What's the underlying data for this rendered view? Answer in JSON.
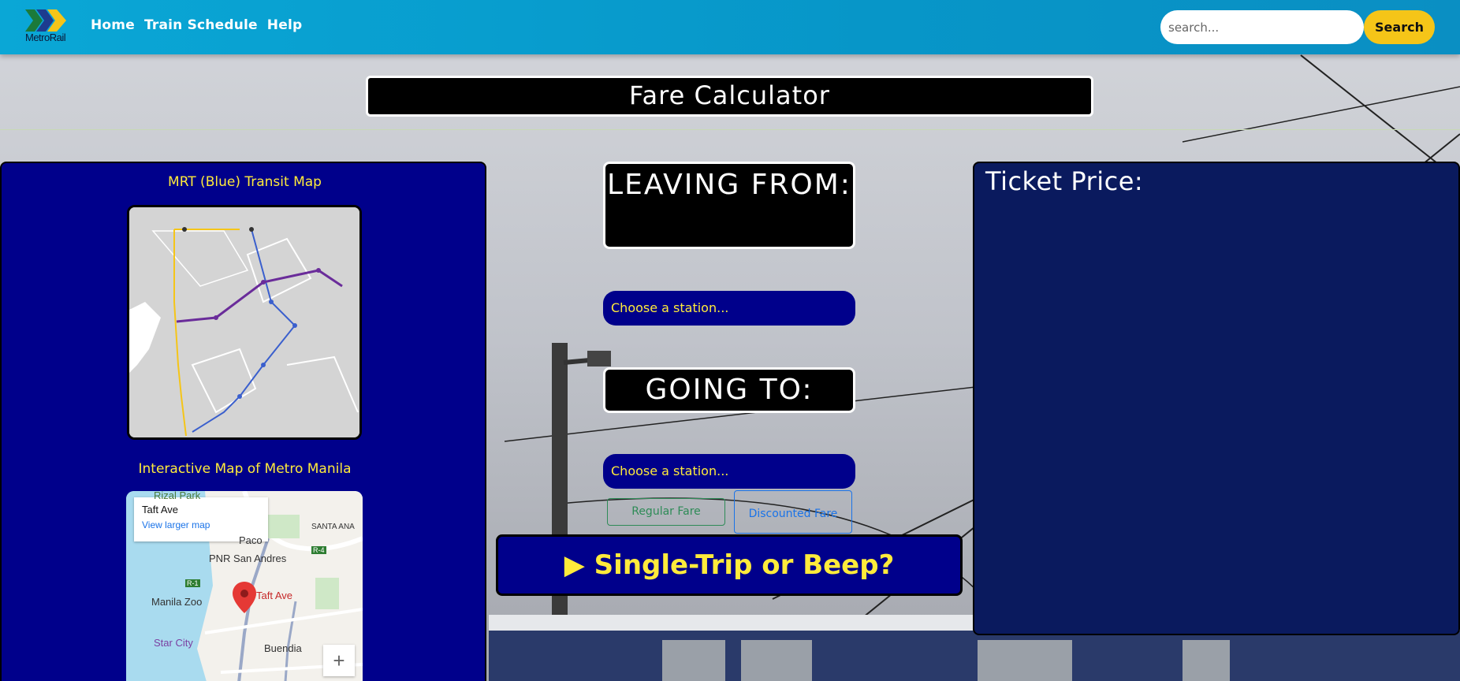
{
  "nav": {
    "logo_text": "MetroRail",
    "links": [
      "Home",
      "Train Schedule",
      "Help"
    ],
    "search_placeholder": "search...",
    "search_button": "Search"
  },
  "title": "Fare Calculator",
  "left_panel": {
    "transit_map_heading": "MRT (Blue) Transit Map",
    "interactive_map_heading": "Interactive Map of Metro Manila",
    "gmap": {
      "place_title": "Taft Ave",
      "view_larger": "View larger map",
      "labels": [
        "Rizal Park",
        "Paco",
        "PNR San Andres",
        "Manila Zoo",
        "Taft Ave",
        "Star City",
        "Buendia",
        "SANTA ANA",
        "R-1",
        "R-4"
      ],
      "zoom_in": "+"
    }
  },
  "center": {
    "leaving_label": "LEAVING FROM:",
    "leaving_select": "Choose a station...",
    "going_label": "GOING TO:",
    "going_select": "Choose a station...",
    "regular_fare": "Regular Fare",
    "discounted_fare": "Discounted Fare",
    "summary": "▶ Single-Trip or Beep?"
  },
  "right_panel": {
    "heading": "Ticket Price:"
  },
  "colors": {
    "nav": "#0aa7d6",
    "panel_blue": "#00008b",
    "accent_yellow": "#ffeb3b",
    "search_button": "#f5c518"
  }
}
